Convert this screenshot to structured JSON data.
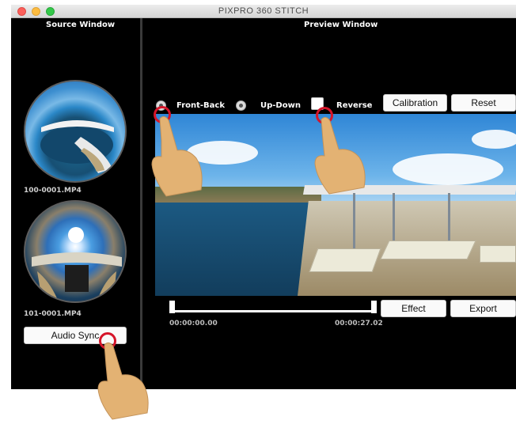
{
  "window": {
    "title": "PIXPRO 360 STITCH"
  },
  "source": {
    "title": "Source Window",
    "files": [
      {
        "name": "100-0001.MP4"
      },
      {
        "name": "101-0001.MP4"
      }
    ],
    "audio_sync_label": "Audio Sync"
  },
  "preview": {
    "title": "Preview Window",
    "modes": [
      {
        "label": "Front-Back",
        "selected": true
      },
      {
        "label": "Up-Down",
        "selected": false
      }
    ],
    "reverse_label": "Reverse",
    "calibration_label": "Calibration",
    "reset_label": "Reset",
    "start_time": "00:00:00.00",
    "end_time": "00:00:27.02",
    "effect_label": "Effect",
    "export_label": "Export"
  },
  "colors": {
    "window_bg": "#000000",
    "highlight_ring": "#d6152a",
    "hand": "#e3b273"
  }
}
